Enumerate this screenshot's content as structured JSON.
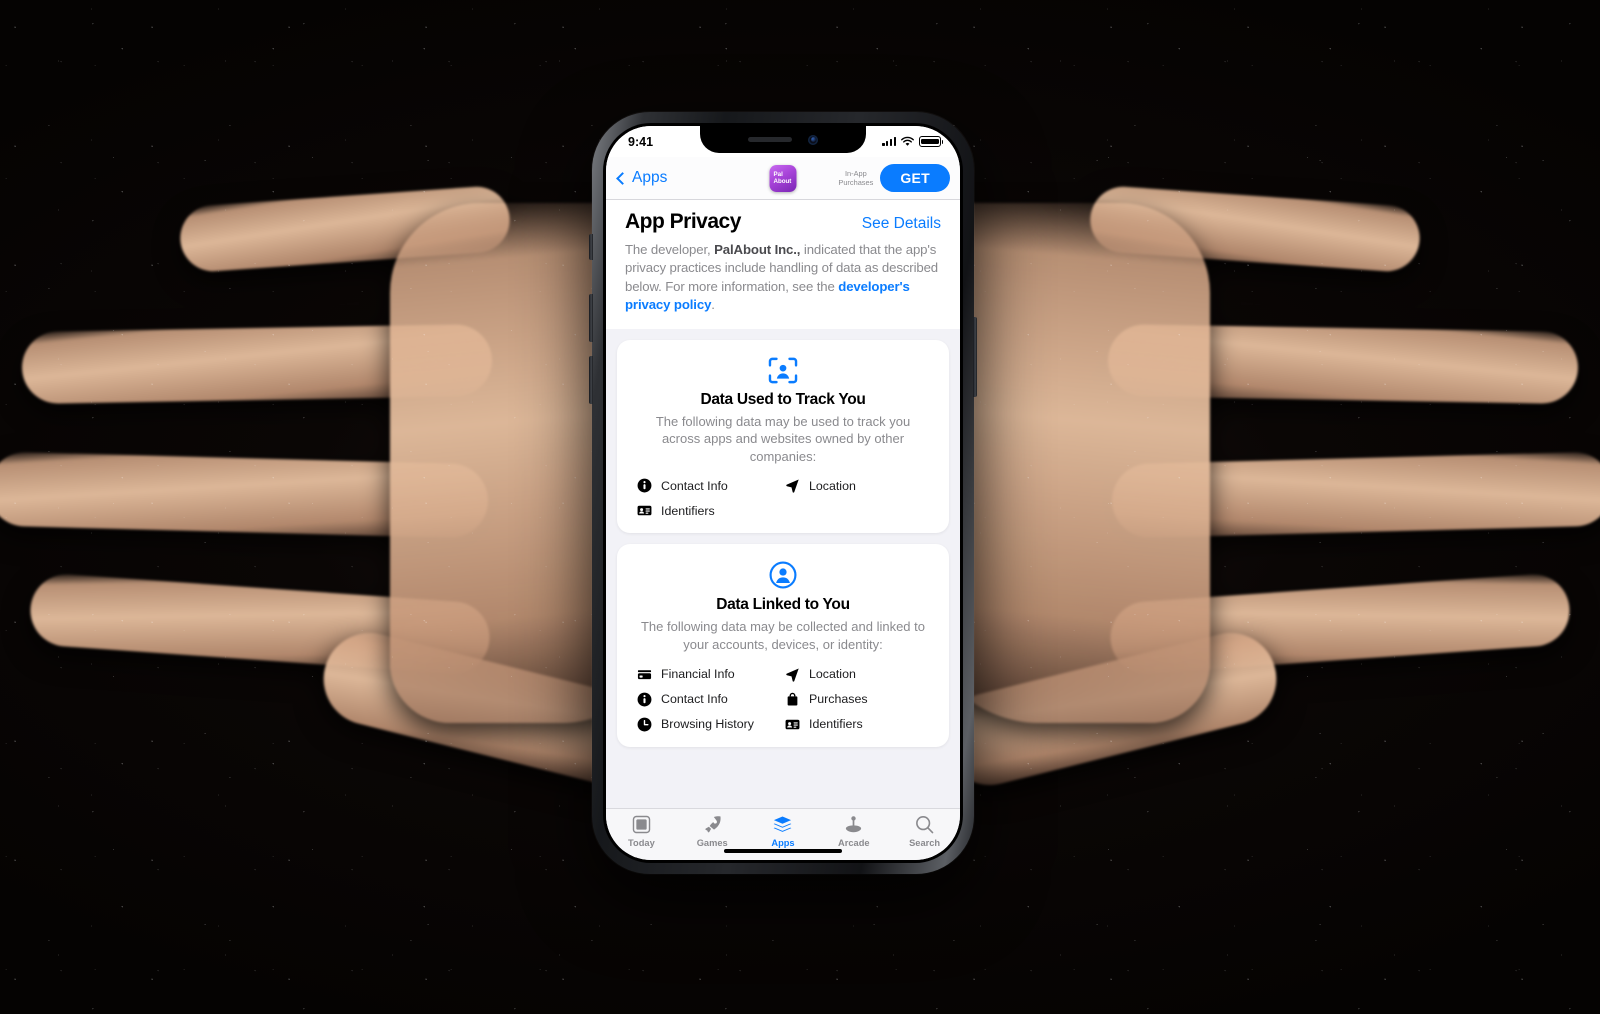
{
  "statusbar": {
    "time": "9:41",
    "cellular_icon": "signal-bars-icon",
    "wifi_icon": "wifi-icon",
    "battery_icon": "battery-icon"
  },
  "navbar": {
    "back_label": "Apps",
    "back_icon": "chevron-left-icon",
    "app_icon_line1": "Pal",
    "app_icon_line2": "About",
    "in_app_purchases_label": "In-App\nPurchases",
    "get_label": "GET"
  },
  "header": {
    "title": "App Privacy",
    "see_details_label": "See Details",
    "intro_prefix": "The developer, ",
    "intro_developer": "PalAbout Inc.,",
    "intro_middle": " indicated that the app's privacy practices include handling of data as described below. For more information, see the ",
    "intro_link": "developer's privacy policy",
    "intro_suffix": "."
  },
  "cards": [
    {
      "icon": "track-person-viewfinder-icon",
      "title": "Data Used to Track You",
      "description": "The following data may be used to track you across apps and websites owned by other companies:",
      "items": [
        {
          "icon": "info-circle-icon",
          "label": "Contact Info"
        },
        {
          "icon": "location-arrow-icon",
          "label": "Location"
        },
        {
          "icon": "identification-card-icon",
          "label": "Identifiers"
        }
      ]
    },
    {
      "icon": "person-circle-icon",
      "title": "Data Linked to You",
      "description": "The following data may be collected and linked to your accounts, devices, or identity:",
      "items": [
        {
          "icon": "credit-card-icon",
          "label": "Financial Info"
        },
        {
          "icon": "location-arrow-icon",
          "label": "Location"
        },
        {
          "icon": "info-circle-icon",
          "label": "Contact Info"
        },
        {
          "icon": "shopping-bag-icon",
          "label": "Purchases"
        },
        {
          "icon": "clock-icon",
          "label": "Browsing History"
        },
        {
          "icon": "identification-card-icon",
          "label": "Identifiers"
        }
      ]
    }
  ],
  "tabbar": {
    "tabs": [
      {
        "icon": "today-card-icon",
        "label": "Today",
        "active": false
      },
      {
        "icon": "rocket-icon",
        "label": "Games",
        "active": false
      },
      {
        "icon": "layers-icon",
        "label": "Apps",
        "active": true
      },
      {
        "icon": "arcade-joystick-icon",
        "label": "Arcade",
        "active": false
      },
      {
        "icon": "search-icon",
        "label": "Search",
        "active": false
      }
    ]
  },
  "colors": {
    "accent_blue": "#0a7cff",
    "page_background": "#f2f2f7",
    "card_background": "#ffffff",
    "secondary_text": "#8a8a8e",
    "app_icon_purple": "#a743d8"
  }
}
